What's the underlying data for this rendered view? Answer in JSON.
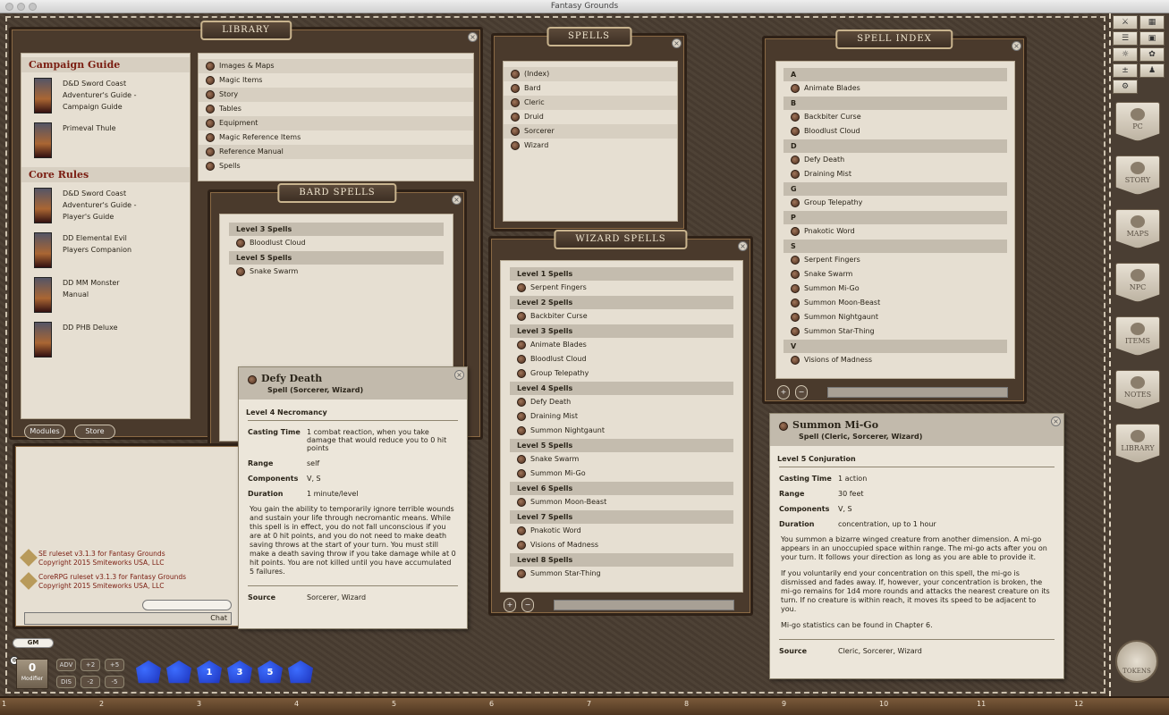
{
  "app": {
    "title": "Fantasy Grounds"
  },
  "library": {
    "title": "LIBRARY",
    "sections": [
      {
        "name": "Campaign Guide",
        "books": [
          "D&D Sword Coast Adventurer's Guide - Campaign Guide",
          "Primeval Thule"
        ]
      },
      {
        "name": "Core Rules",
        "books": [
          "D&D Sword Coast Adventurer's Guide - Player's Guide",
          "DD Elemental Evil Players Companion",
          "DD MM Monster Manual",
          "DD PHB Deluxe"
        ]
      }
    ],
    "items": [
      "Images & Maps",
      "Magic Items",
      "Story",
      "Tables",
      "Equipment",
      "Magic Reference Items",
      "Reference Manual",
      "Spells"
    ],
    "modules_label": "Modules",
    "store_label": "Store"
  },
  "spells": {
    "title": "SPELLS",
    "items": [
      "(Index)",
      "Bard",
      "Cleric",
      "Druid",
      "Sorcerer",
      "Wizard"
    ]
  },
  "bard": {
    "title": "BARD SPELLS",
    "groups": [
      {
        "level": "Level 3 Spells",
        "spells": [
          "Bloodlust Cloud"
        ]
      },
      {
        "level": "Level 5 Spells",
        "spells": [
          "Snake Swarm"
        ]
      }
    ]
  },
  "wizard": {
    "title": "WIZARD SPELLS",
    "groups": [
      {
        "level": "Level 1 Spells",
        "spells": [
          "Serpent Fingers"
        ]
      },
      {
        "level": "Level 2 Spells",
        "spells": [
          "Backbiter Curse"
        ]
      },
      {
        "level": "Level 3 Spells",
        "spells": [
          "Animate Blades",
          "Bloodlust Cloud",
          "Group Telepathy"
        ]
      },
      {
        "level": "Level 4 Spells",
        "spells": [
          "Defy Death",
          "Draining Mist",
          "Summon Nightgaunt"
        ]
      },
      {
        "level": "Level 5 Spells",
        "spells": [
          "Snake Swarm",
          "Summon Mi-Go"
        ]
      },
      {
        "level": "Level 6 Spells",
        "spells": [
          "Summon Moon-Beast"
        ]
      },
      {
        "level": "Level 7 Spells",
        "spells": [
          "Pnakotic Word",
          "Visions of Madness"
        ]
      },
      {
        "level": "Level 8 Spells",
        "spells": [
          "Summon Star-Thing"
        ]
      }
    ]
  },
  "index": {
    "title": "SPELL INDEX",
    "groups": [
      {
        "letter": "A",
        "spells": [
          "Animate Blades"
        ]
      },
      {
        "letter": "B",
        "spells": [
          "Backbiter Curse",
          "Bloodlust Cloud"
        ]
      },
      {
        "letter": "D",
        "spells": [
          "Defy Death",
          "Draining Mist"
        ]
      },
      {
        "letter": "G",
        "spells": [
          "Group Telepathy"
        ]
      },
      {
        "letter": "P",
        "spells": [
          "Pnakotic Word"
        ]
      },
      {
        "letter": "S",
        "spells": [
          "Serpent Fingers",
          "Snake Swarm",
          "Summon Mi-Go",
          "Summon Moon-Beast",
          "Summon Nightgaunt",
          "Summon Star-Thing"
        ]
      },
      {
        "letter": "V",
        "spells": [
          "Visions of Madness"
        ]
      }
    ]
  },
  "defy": {
    "name": "Defy Death",
    "sub": "Spell (Sorcerer, Wizard)",
    "school": "Level 4 Necromancy",
    "props": [
      {
        "k": "Casting Time",
        "v": "1 combat reaction, when you take damage that would reduce you to 0 hit points"
      },
      {
        "k": "Range",
        "v": "self"
      },
      {
        "k": "Components",
        "v": "V, S"
      },
      {
        "k": "Duration",
        "v": "1 minute/level"
      }
    ],
    "text": "You gain the ability to temporarily ignore terrible wounds and sustain your life through necromantic means. While this spell is in effect, you do not fall unconscious if you are at 0 hit points, and you do not need to make death saving throws at the start of your turn. You must still make a death saving throw if you take damage while at 0 hit points. You are not killed until you have accumulated 5 failures.",
    "source_k": "Source",
    "source_v": "Sorcerer, Wizard"
  },
  "migo": {
    "name": "Summon Mi-Go",
    "sub": "Spell (Cleric, Sorcerer, Wizard)",
    "school": "Level 5 Conjuration",
    "props": [
      {
        "k": "Casting Time",
        "v": "1 action"
      },
      {
        "k": "Range",
        "v": "30 feet"
      },
      {
        "k": "Components",
        "v": "V, S"
      },
      {
        "k": "Duration",
        "v": "concentration, up to 1 hour"
      }
    ],
    "paras": [
      "You summon a bizarre winged creature from another dimension. A mi-go appears in an unoccupied space within range. The mi-go acts after you on your turn. It follows your direction as long as you are able to provide it.",
      "If you voluntarily end your concentration on this spell, the mi-go is dismissed and fades away. If, however, your concentration is broken, the mi-go remains for 1d4 more rounds and attacks the nearest creature on its turn. If no creature is within reach, it moves its speed to be adjacent to you.",
      "Mi-go statistics can be found in Chapter 6."
    ],
    "source_k": "Source",
    "source_v": "Cleric, Sorcerer, Wizard"
  },
  "chat": {
    "lines": [
      {
        "a": "SE ruleset v3.1.3 for Fantasy Grounds",
        "b": "Copyright 2015 Smiteworks USA, LLC"
      },
      {
        "a": "CoreRPG ruleset v3.1.3 for Fantasy Grounds",
        "b": "Copyright 2015 Smiteworks USA, LLC"
      }
    ],
    "chat_label": "Chat",
    "gm_label": "GM"
  },
  "modifier": {
    "value": "0",
    "label": "Modifier"
  },
  "mods": [
    "ADV",
    "+2",
    "+5",
    "DIS",
    "-2",
    "-5"
  ],
  "dice": [
    "",
    "",
    "1",
    "3",
    "5",
    ""
  ],
  "sidebar": [
    "PC",
    "STORY",
    "MAPS",
    "NPC",
    "ITEMS",
    "NOTES",
    "LIBRARY"
  ],
  "tokens_label": "TOKENS",
  "ruler": [
    "1",
    "2",
    "3",
    "4",
    "5",
    "6",
    "7",
    "8",
    "9",
    "10",
    "11",
    "12"
  ]
}
